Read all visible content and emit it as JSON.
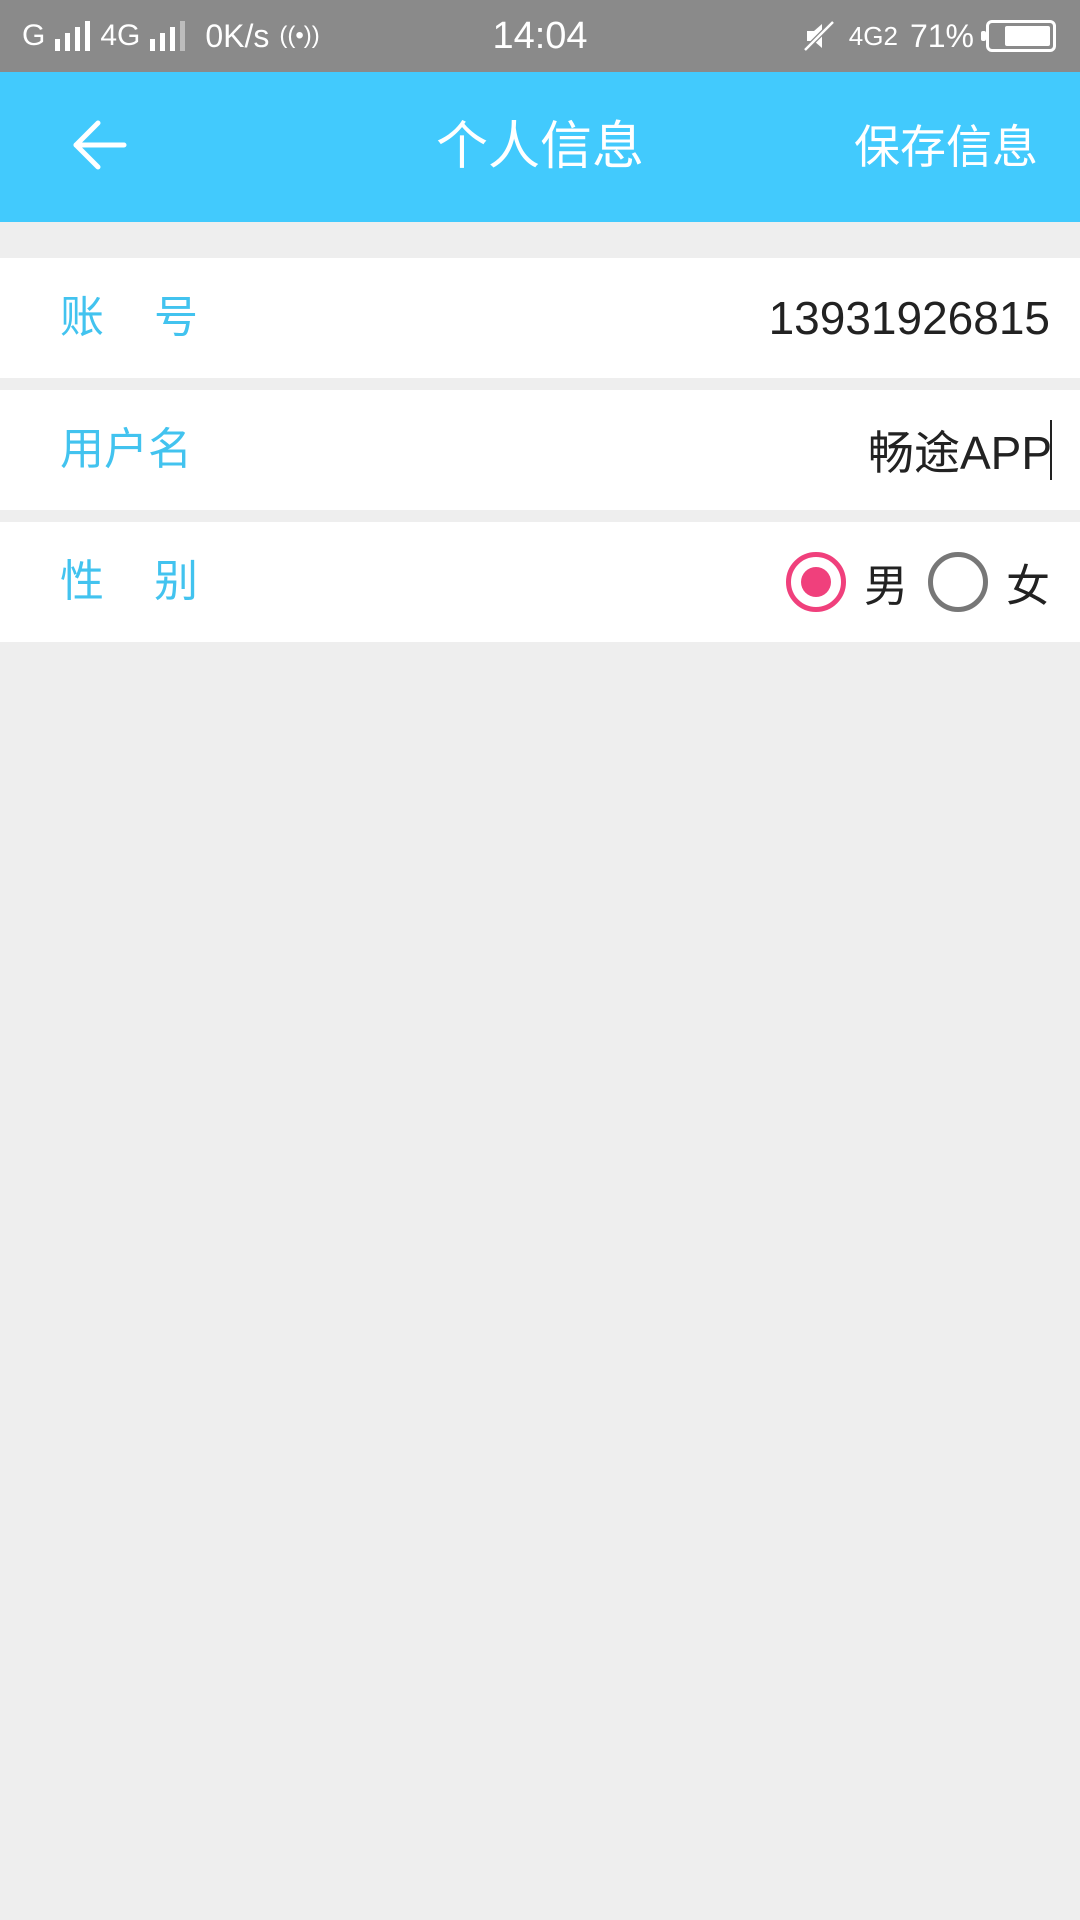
{
  "status_bar": {
    "network_1": "G",
    "network_2": "4G",
    "speed": "0K/s",
    "hotspot": "((•))",
    "time": "14:04",
    "network_right": "4G2",
    "battery_percent": "71%",
    "battery_level": 0.71
  },
  "app_bar": {
    "title": "个人信息",
    "save_label": "保存信息",
    "back_icon": "arrow-left-icon",
    "background_color": "#42cafd"
  },
  "form": {
    "account": {
      "label": "账号",
      "value": "13931926815"
    },
    "username": {
      "label": "用户名",
      "value": "畅途APP"
    },
    "gender": {
      "label": "性别",
      "options": [
        {
          "label": "男",
          "selected": true
        },
        {
          "label": "女",
          "selected": false
        }
      ],
      "accent_color": "#f0407c"
    },
    "label_color": "#42c3ef"
  }
}
